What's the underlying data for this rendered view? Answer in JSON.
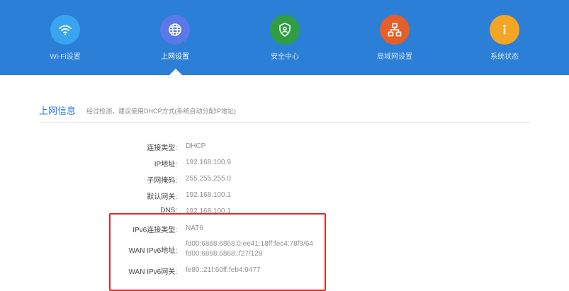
{
  "nav": {
    "items": [
      {
        "label": "Wi-Fi设置",
        "icon": "wifi-icon",
        "color": "#3aa5ef"
      },
      {
        "label": "上网设置",
        "icon": "globe-icon",
        "color": "#5b78e8"
      },
      {
        "label": "安全中心",
        "icon": "shield-icon",
        "color": "#2f9e43"
      },
      {
        "label": "局域网设置",
        "icon": "network-icon",
        "color": "#e55f2a"
      },
      {
        "label": "系统状态",
        "icon": "info-icon",
        "color": "#f5a524"
      }
    ],
    "active_index": 1
  },
  "section": {
    "title": "上网信息",
    "hint": "经过检测，建议使用DHCP方式(系统自动分配IP地址)"
  },
  "info": {
    "connection_type": {
      "label": "连接类型:",
      "value": "DHCP"
    },
    "ip": {
      "label": "IP地址:",
      "value": "192.168.100.9"
    },
    "mask": {
      "label": "子网掩码:",
      "value": "255.255.255.0"
    },
    "gateway": {
      "label": "默认网关:",
      "value": "192.168.100.1"
    },
    "dns": {
      "label": "DNS:",
      "value": "192.168.100.1"
    },
    "ipv6_type": {
      "label": "IPv6连接类型:",
      "value": "NAT6"
    },
    "wan_ipv6_addr": {
      "label": "WAN IPv6地址:",
      "value_1": "fd00:6868:6868:0:ee41:18ff:fec4:78f9/64",
      "value_2": "fd00:6868:6868::f27/128"
    },
    "wan_ipv6_gw": {
      "label": "WAN IPv6网关:",
      "value": "fe80::21f:60ff:feb4:9477"
    }
  },
  "colors": {
    "header_bg": "#2b7fd6",
    "accent": "#2f7fd6",
    "highlight": "#e02a2a"
  }
}
